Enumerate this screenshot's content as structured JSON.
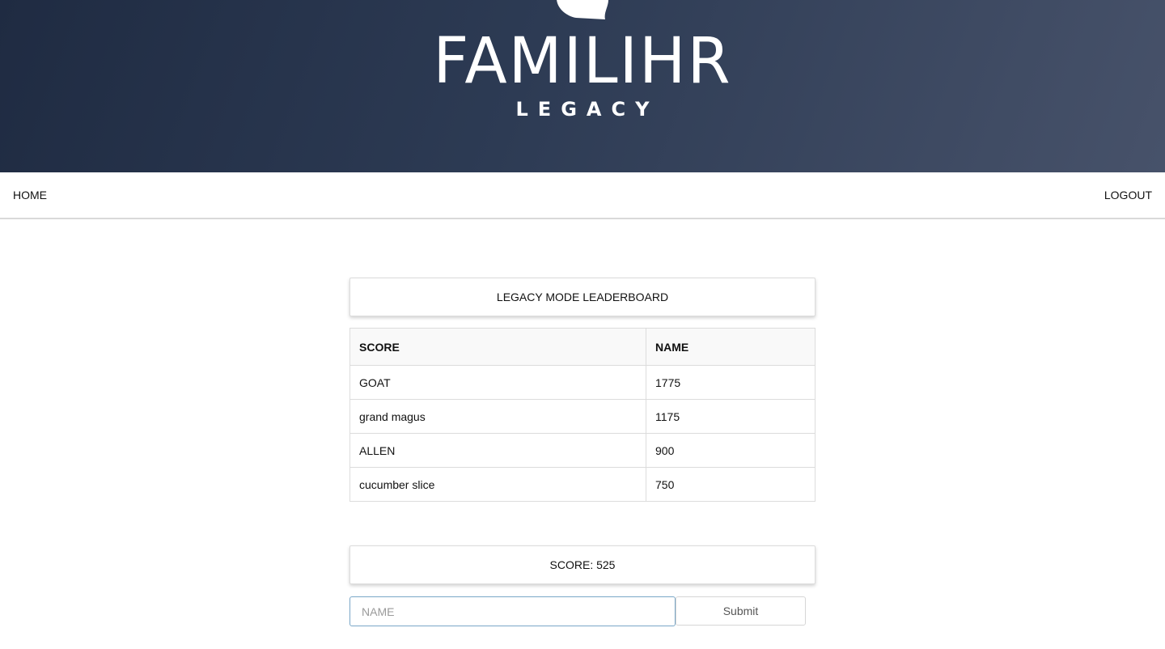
{
  "brand": {
    "wordmark": "FAMILIHR",
    "subtitle": "LEGACY",
    "icon": "silhouette-head-icon"
  },
  "nav": {
    "home_label": "HOME",
    "logout_label": "LOGOUT"
  },
  "leaderboard": {
    "title": "LEGACY MODE LEADERBOARD",
    "headers": [
      "SCORE",
      "NAME"
    ],
    "rows": [
      [
        "GOAT",
        "1775"
      ],
      [
        "grand magus",
        "1175"
      ],
      [
        "ALLEN",
        "900"
      ],
      [
        "cucumber slice",
        "750"
      ]
    ]
  },
  "score": {
    "label": "SCORE: 525"
  },
  "form": {
    "name_placeholder": "NAME",
    "name_value": "",
    "submit_label": "Submit"
  },
  "colors": {
    "header_dark": "#1f2b42",
    "header_light": "#47526a",
    "input_focus_border": "#7aa7c7"
  }
}
